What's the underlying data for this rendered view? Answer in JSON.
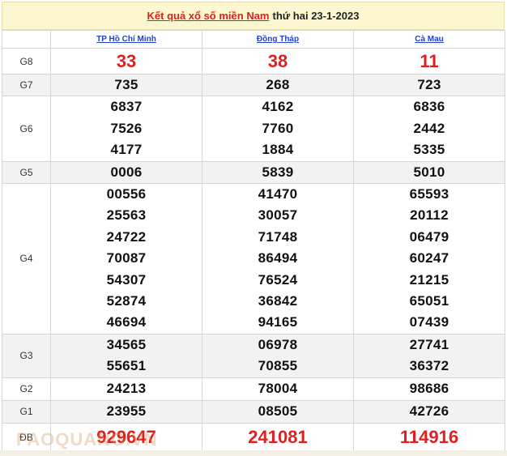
{
  "header": {
    "title_link": "Kết quả xổ số miền Nam",
    "date_text": "thứ hai 23-1-2023"
  },
  "provinces": [
    "TP Hồ Chí Minh",
    "Đồng Tháp",
    "Cà Mau"
  ],
  "rows": [
    {
      "label": "G8",
      "values": [
        [
          "33"
        ],
        [
          "38"
        ],
        [
          "11"
        ]
      ]
    },
    {
      "label": "G7",
      "values": [
        [
          "735"
        ],
        [
          "268"
        ],
        [
          "723"
        ]
      ]
    },
    {
      "label": "G6",
      "values": [
        [
          "6837",
          "7526",
          "4177"
        ],
        [
          "4162",
          "7760",
          "1884"
        ],
        [
          "6836",
          "2442",
          "5335"
        ]
      ]
    },
    {
      "label": "G5",
      "values": [
        [
          "0006"
        ],
        [
          "5839"
        ],
        [
          "5010"
        ]
      ]
    },
    {
      "label": "G4",
      "values": [
        [
          "00556",
          "25563",
          "24722",
          "70087",
          "54307",
          "52874",
          "46694"
        ],
        [
          "41470",
          "30057",
          "71748",
          "86494",
          "76524",
          "36842",
          "94165"
        ],
        [
          "65593",
          "20112",
          "06479",
          "60247",
          "21215",
          "65051",
          "07439"
        ]
      ]
    },
    {
      "label": "G3",
      "values": [
        [
          "34565",
          "55651"
        ],
        [
          "06978",
          "70855"
        ],
        [
          "27741",
          "36372"
        ]
      ]
    },
    {
      "label": "G2",
      "values": [
        [
          "24213"
        ],
        [
          "78004"
        ],
        [
          "98686"
        ]
      ]
    },
    {
      "label": "G1",
      "values": [
        [
          "23955"
        ],
        [
          "08505"
        ],
        [
          "42726"
        ]
      ]
    },
    {
      "label": "ĐB",
      "values": [
        [
          "929647"
        ],
        [
          "241081"
        ],
        [
          "114916"
        ]
      ]
    }
  ],
  "watermark": "FAOQUANG.VN",
  "colors": {
    "accent_red": "#e02020",
    "link_blue": "#2440c8",
    "title_bg": "#fdf7d1"
  }
}
